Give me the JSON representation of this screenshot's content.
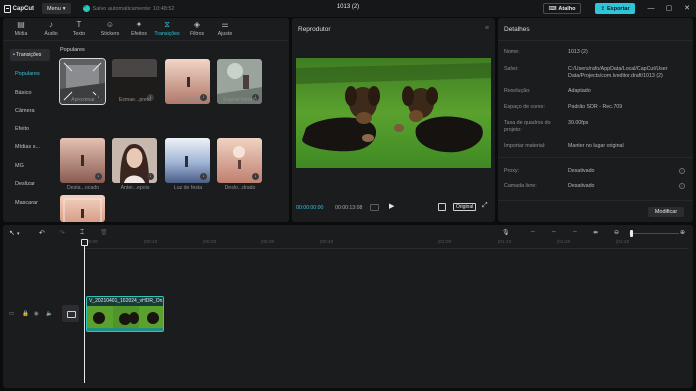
{
  "titlebar": {
    "app_name": "CapCut",
    "menu_label": "Menu",
    "save_status": "Salvo automaticamente: 10:48:52",
    "doc_title": "1013 (2)",
    "shortcut_label": "Atalho",
    "export_label": "Exportar",
    "minimize": "—",
    "maximize": "▢",
    "close": "✕"
  },
  "media_tabs": [
    {
      "label": "Mídia",
      "icon": "▤"
    },
    {
      "label": "Áudio",
      "icon": "♪"
    },
    {
      "label": "Texto",
      "icon": "T"
    },
    {
      "label": "Stickers",
      "icon": "☺"
    },
    {
      "label": "Efeitos",
      "icon": "✦"
    },
    {
      "label": "Transições",
      "icon": "⧖"
    },
    {
      "label": "Filtros",
      "icon": "◈"
    },
    {
      "label": "Ajuste",
      "icon": "⚌"
    }
  ],
  "categories": {
    "header": "• Transições",
    "items": [
      "Populares",
      "Básico",
      "Câmera",
      "Efeito",
      "Mídias s...",
      "MG",
      "Deslizar",
      "Mascarar"
    ]
  },
  "section_title": "Populares",
  "thumbnails": [
    {
      "label": "Aproximar"
    },
    {
      "label": "Esmae...preto"
    },
    {
      "label": "Combinar"
    },
    {
      "label": "Espiral horário"
    },
    {
      "label": "Desta...ocado"
    },
    {
      "label": "Anter...epois"
    },
    {
      "label": "Luz de festa"
    },
    {
      "label": "Deslo...drado"
    },
    {
      "label": ""
    }
  ],
  "player": {
    "title": "Reprodutor",
    "menu_icon": "≡",
    "time_current": "00:00:00:00",
    "time_total": "00:00:13:08",
    "play_icon": "▶",
    "original_label": "Original",
    "fullscreen_icon": "⤢"
  },
  "details": {
    "title": "Detalhes",
    "menu_icon": "≡",
    "rows": [
      {
        "key": "Nome:",
        "value": "1013 (2)"
      },
      {
        "key": "Salvo:",
        "value": "C:/Users/rafo/AppData/Local/CapCut/User Data/Projects/com.lveditor.draft/1013 (2)"
      },
      {
        "key": "Resolução:",
        "value": "Adaptado"
      },
      {
        "key": "Espaço de cores:",
        "value": "Padrão SDR - Rec.709"
      },
      {
        "key": "Taxa de quadros do projeto:",
        "value": "30.00fps"
      },
      {
        "key": "Importar material:",
        "value": "Manter no lugar original"
      },
      {
        "key": "Proxy:",
        "value": "Desativado"
      },
      {
        "key": "Camada livre:",
        "value": "Desativado"
      }
    ],
    "modify_label": "Modificar"
  },
  "timeline": {
    "ruler": [
      "00:00",
      "|00:10",
      "|00:20",
      "|00:30",
      "|00:40",
      "|01:00",
      "|01:10",
      "|01:20",
      "|01:30"
    ],
    "clip_label": "V_20210401_162024_vHDR_On",
    "tools": {
      "select": "↖",
      "undo": "↶",
      "redo": "↷",
      "split": "⌶",
      "delete": "🗑"
    }
  },
  "colors": {
    "accent": "#2fc5d9",
    "panel": "#1b1c1e",
    "background": "#0c0c0d"
  }
}
